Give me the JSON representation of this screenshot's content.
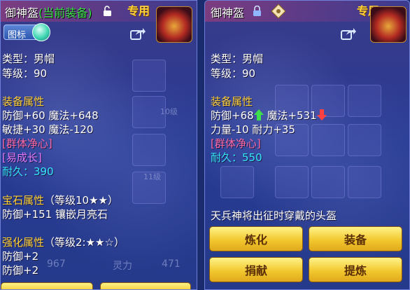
{
  "colors": {
    "accent_gold": "#ffd23a",
    "highlight_green": "#3de04a",
    "attr_pink": "#ff6aa8",
    "attr_violet": "#e27bff",
    "durability_cyan": "#35e6ff",
    "button_yellow": "#f2c82f",
    "arrow_up": "#3de04a",
    "arrow_down": "#ff4040"
  },
  "left_panel": {
    "item_name": "御神盔",
    "equipped_tag": "(当前装备)",
    "exclusive": "专用",
    "icon_toggle_label": "图标",
    "type_line": "类型：男帽",
    "level_line": "等级：90",
    "attr_header": "装备属性",
    "attr_lines": [
      "防御+60 魔法+648",
      "敏捷+30 魔法-120"
    ],
    "effect": "[群体净心]",
    "effect2": "[易成长]",
    "durability_label": "耐久：",
    "durability_value": "390",
    "gem_header": "宝石属性",
    "gem_level": "（等级10★★）",
    "gem_line": "防御+151 镶嵌月亮石",
    "enhance_header": "强化属性",
    "enhance_level": "（等级2:★★☆）",
    "enhance_lines": [
      "防御+2",
      "防御+2"
    ],
    "background_text": [
      "10级",
      "11级",
      "967",
      "灵力",
      "471"
    ]
  },
  "right_panel": {
    "item_name": "御神盔",
    "exclusive": "专用",
    "type_line": "类型：男帽",
    "level_line": "等级：90",
    "attr_header": "装备属性",
    "attr_line1_a": "防御+68",
    "attr_line1_b": "魔法+531",
    "attr_line2": "力量-10 耐力+35",
    "effect": "[群体净心]",
    "durability_label": "耐久：",
    "durability_value": "550",
    "description": "天兵神将出征时穿戴的头盔",
    "buttons": {
      "refine": "炼化",
      "equip": "装备",
      "donate": "捐献",
      "extract": "提炼"
    }
  }
}
